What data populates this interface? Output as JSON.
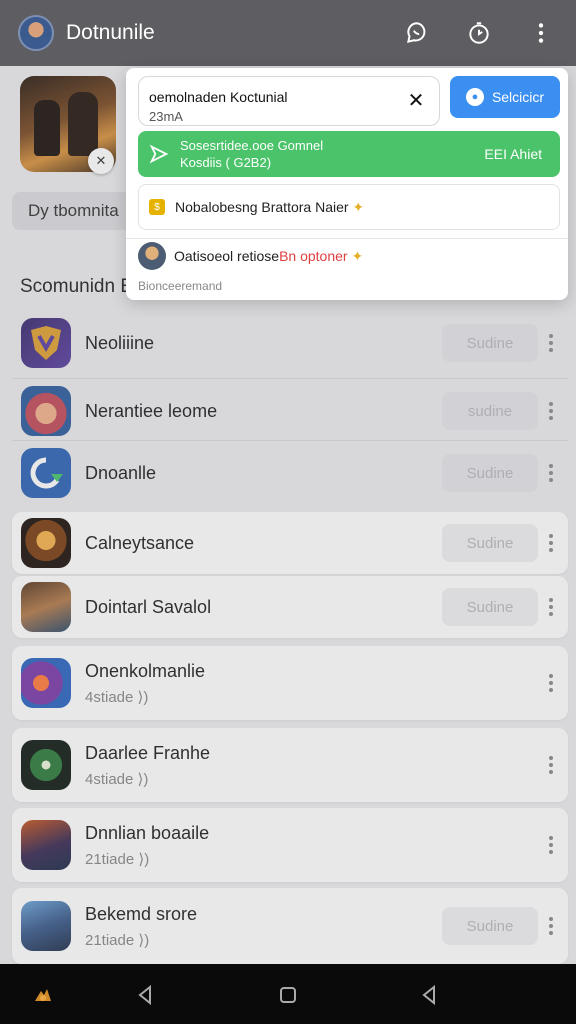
{
  "header": {
    "title": "Dotnunile",
    "icons": [
      "profile-avatar",
      "chat-bubble-icon",
      "timer-icon",
      "more-vertical-icon"
    ]
  },
  "background": {
    "search_text": "Dy tbomnita",
    "section_title": "Scomunidn E"
  },
  "popup": {
    "field_title": "oemolnaden Koctunial",
    "field_sub": "23mA",
    "primary_button": "Selcicicr",
    "green_line1": "Sosesrtidee.ooe Gomnel",
    "green_line2": "Kosdiis ( G2B2)",
    "green_right": "EEI Ahiet",
    "notice_text": "Nobalobesng Brattora Naier",
    "user_text_plain": "Oatisoeol retiose",
    "user_text_red": "Bn optoner",
    "footnote": "Bionceeremand"
  },
  "apps": [
    {
      "name": "Neoliiine",
      "action": "Sudine",
      "icon": "shield-app-icon",
      "card": false
    },
    {
      "name": "Nerantiee leome",
      "action": "sudine",
      "icon": "hero-app-icon",
      "card": false
    },
    {
      "name": "Dnoanlle",
      "action": "Sudine",
      "icon": "download-app-icon",
      "card": false
    },
    {
      "name": "Calneytsance",
      "action": "Sudine",
      "icon": "warrior-app-icon",
      "card": true
    },
    {
      "name": "Dointarl Savalol",
      "action": "Sudine",
      "icon": "rogue-app-icon",
      "card": true
    },
    {
      "name": "Onenkolmanlie",
      "sub": "4stiade  ⟩)",
      "icon": "mage-app-icon",
      "card": true
    },
    {
      "name": "Daarlee Franhe",
      "sub": "4stiade  ⟩)",
      "icon": "orb-app-icon",
      "card": true
    },
    {
      "name": "Dnnlian boaaile",
      "sub": "21tiade  ⟩)",
      "icon": "knight-app-icon",
      "card": true
    },
    {
      "name": "Bekemd srore",
      "sub": "21tiade  ⟩)",
      "action": "Sudine",
      "icon": "soldier-app-icon",
      "card": true
    }
  ],
  "colors": {
    "topbar": "#5e5e62",
    "primary_blue": "#3b8ff0",
    "green": "#4bc36a",
    "accent_red": "#e04040"
  },
  "nav": [
    "home-app-icon",
    "back-icon",
    "home-square-icon",
    "recent-back-icon"
  ]
}
